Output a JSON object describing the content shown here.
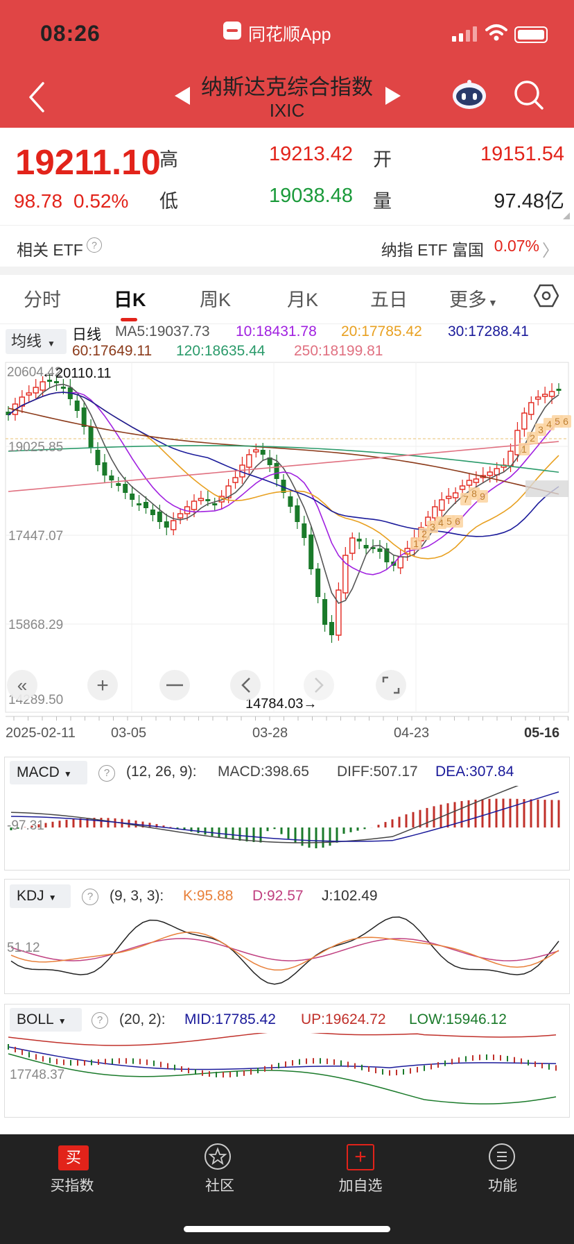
{
  "status_bar": {
    "time": "08:26",
    "app": "同花顺App"
  },
  "header": {
    "title": "纳斯达克综合指数",
    "subtitle": "IXIC"
  },
  "quote": {
    "price": "19211.10",
    "change": "98.78",
    "change_pct": "0.52%",
    "high_label": "高",
    "high": "19213.42",
    "low_label": "低",
    "low": "19038.48",
    "open_label": "开",
    "open": "19151.54",
    "volume_label": "量",
    "volume": "97.48亿"
  },
  "etf": {
    "label": "相关 ETF",
    "name": "纳指 ETF 富国",
    "value": "0.07%"
  },
  "tabs": [
    "分时",
    "日K",
    "周K",
    "月K",
    "五日",
    "更多"
  ],
  "ma": {
    "button": "均线",
    "type": "日线",
    "items": [
      {
        "label": "MA5:19037.73",
        "color": "#555555"
      },
      {
        "label": "10:18431.78",
        "color": "#a020e0"
      },
      {
        "label": "20:17785.42",
        "color": "#e8a020"
      },
      {
        "label": "30:17288.41",
        "color": "#1a1a9a"
      },
      {
        "label": "60:17649.11",
        "color": "#8b3a1a"
      },
      {
        "label": "120:18635.44",
        "color": "#2a9a6a"
      },
      {
        "label": "250:18199.81",
        "color": "#e07080"
      }
    ]
  },
  "kline": {
    "price_labels": [
      "20604.42",
      "19025.85",
      "17447.07",
      "15868.29",
      "14289.50"
    ],
    "high_marker": "←20110.11",
    "low_marker": "14784.03→",
    "dates": [
      "2025-02-11",
      "03-05",
      "03-28",
      "04-23",
      "05-16"
    ],
    "signal_numbers_1": [
      "1",
      "2",
      "3",
      "4",
      "5",
      "6",
      "7",
      "8",
      "9"
    ],
    "signal_numbers_2": [
      "1",
      "2",
      "3",
      "4",
      "5",
      "6"
    ]
  },
  "macd": {
    "label": "MACD",
    "params": "(12, 26, 9):",
    "macd": "MACD:398.65",
    "diff": "DIFF:507.17",
    "dea": "DEA:307.84",
    "axis": "-97.31"
  },
  "kdj": {
    "label": "KDJ",
    "params": "(9, 3, 3):",
    "k": "K:95.88",
    "d": "D:92.57",
    "j": "J:102.49",
    "axis": "51.12"
  },
  "boll": {
    "label": "BOLL",
    "params": "(20, 2):",
    "mid": "MID:17785.42",
    "up": "UP:19624.72",
    "low": "LOW:15946.12",
    "axis": "17748.37"
  },
  "bottom_nav": [
    {
      "label": "买指数",
      "icon": "buy-icon",
      "glyph": "买"
    },
    {
      "label": "社区",
      "icon": "community-icon"
    },
    {
      "label": "加自选",
      "icon": "add-watchlist-icon",
      "glyph": "+"
    },
    {
      "label": "功能",
      "icon": "menu-icon"
    }
  ],
  "colors": {
    "header": "#e04545",
    "up": "#e2231a",
    "down": "#1a9a3a",
    "nav_bg": "#222222"
  }
}
